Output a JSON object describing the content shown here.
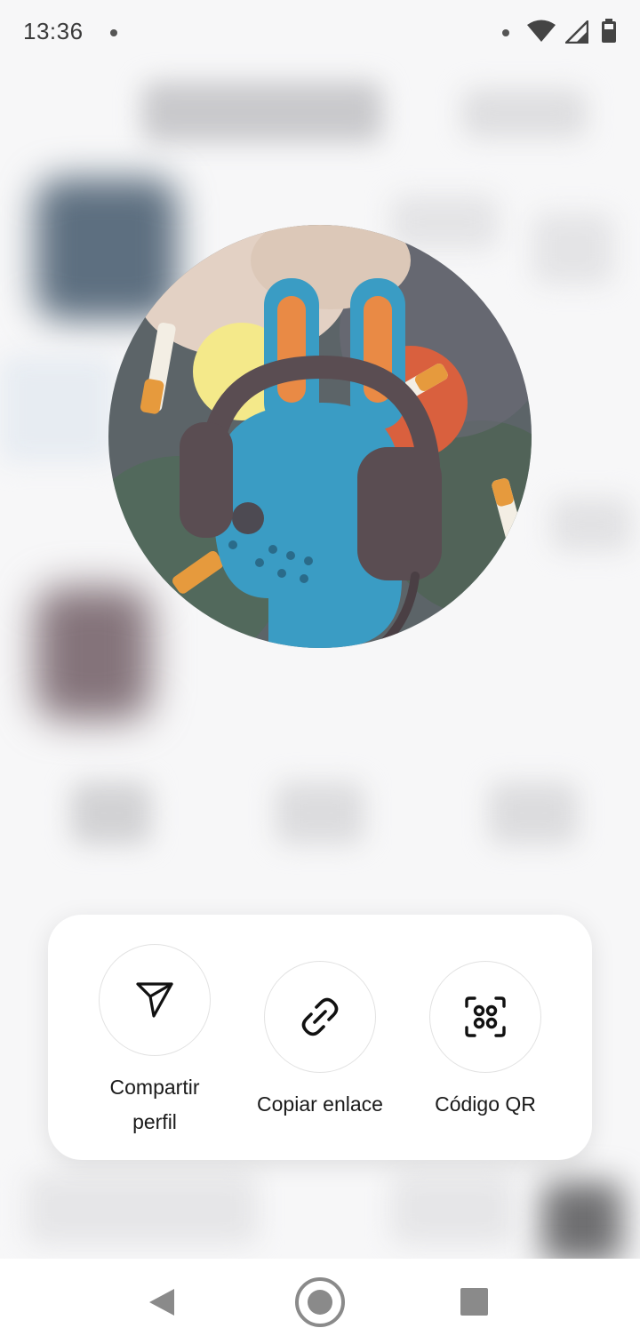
{
  "status_bar": {
    "time": "13:36"
  },
  "profile": {
    "avatar_alt": "Foto de perfil"
  },
  "share_menu": {
    "options": [
      {
        "label": "Compartir perfil",
        "icon": "send-icon"
      },
      {
        "label": "Copiar enlace",
        "icon": "link-icon"
      },
      {
        "label": "Código QR",
        "icon": "qr-code-icon"
      }
    ]
  },
  "nav_bar": {
    "icons": [
      "back-icon",
      "home-icon",
      "recents-icon"
    ]
  }
}
